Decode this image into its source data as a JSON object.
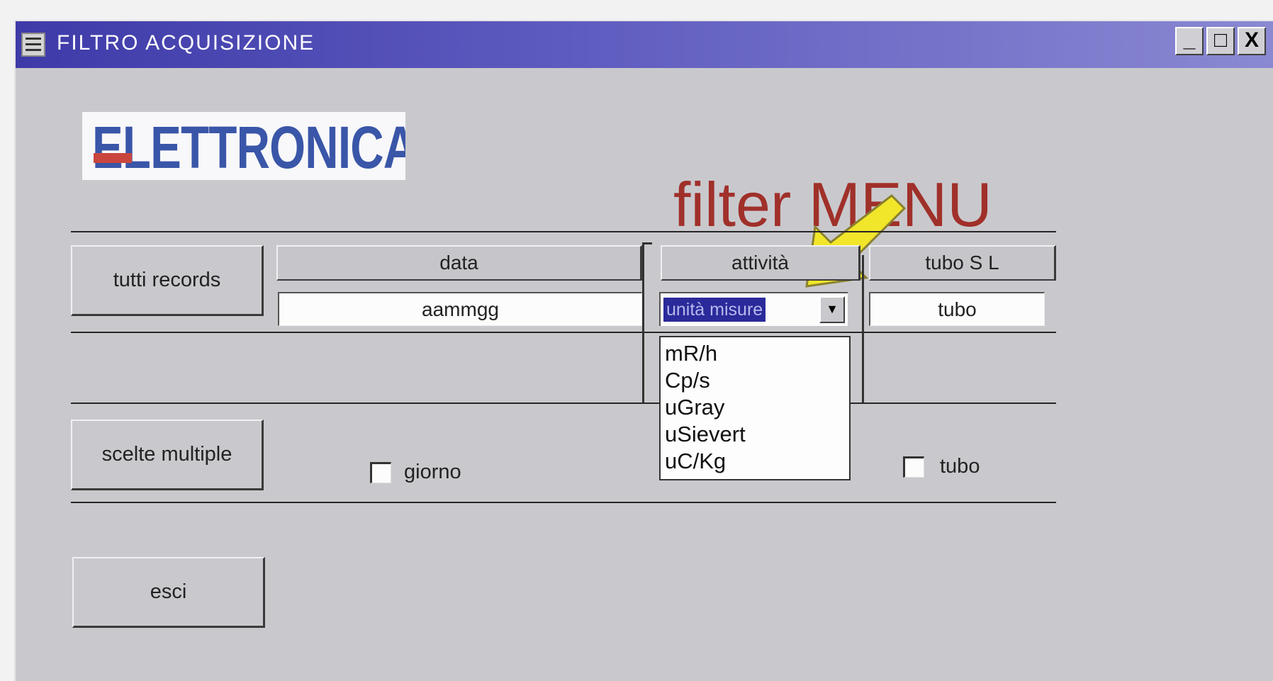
{
  "window": {
    "title": "FILTRO ACQUISIZIONE",
    "controls": {
      "minimize": "_",
      "maximize": "□",
      "close": "X"
    }
  },
  "logo": {
    "text": "ELETTRONICA"
  },
  "heading": "filter MENU",
  "buttons": {
    "all_records": "tutti records",
    "multiple_choices": "scelte multiple",
    "exit": "esci"
  },
  "columns": {
    "data": {
      "header": "data",
      "value": "aammgg"
    },
    "attivita": {
      "header": "attività",
      "selected": "unità misure",
      "options": [
        "mR/h",
        "Cp/s",
        "uGray",
        "uSievert",
        "uC/Kg"
      ]
    },
    "tubo": {
      "header": "tubo S L",
      "value": "tubo"
    }
  },
  "checkboxes": [
    {
      "label": "giorno",
      "checked": false
    },
    {
      "label": "tubo",
      "checked": false
    }
  ],
  "colors": {
    "titlebar": "#3e3aa8",
    "heading": "#a0302a",
    "arrow": "#f2e62a",
    "logo": "#3a56a8"
  },
  "icons": [
    "window-menu-icon",
    "yellow-arrow-icon",
    "dropdown-arrow-icon"
  ]
}
